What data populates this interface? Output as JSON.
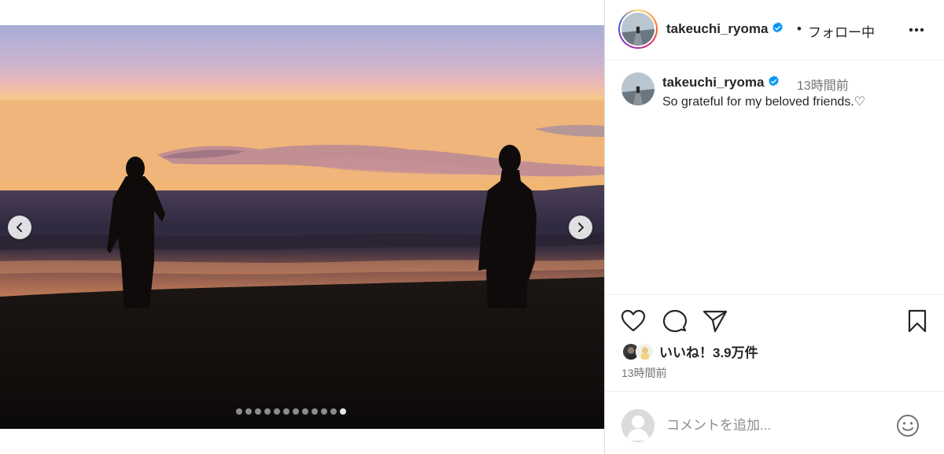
{
  "media": {
    "slide_count": 12,
    "active_slide_index": 11
  },
  "header": {
    "username": "takeuchi_ryoma",
    "separator": "•",
    "follow_status": "フォロー中"
  },
  "caption": {
    "username": "takeuchi_ryoma",
    "time_ago": "13時間前",
    "text": "So grateful for my beloved friends.♡"
  },
  "engagement": {
    "likes_text": "いいね！3.9万件",
    "post_time": "13時間前"
  },
  "comment": {
    "placeholder": "コメントを追加..."
  },
  "colors": {
    "verified": "#0095f6",
    "text_primary": "#262626",
    "text_secondary": "#737373"
  },
  "icons": [
    "chevron-left-icon",
    "chevron-right-icon",
    "more-icon",
    "verified-icon",
    "heart-icon",
    "comment-icon",
    "share-icon",
    "bookmark-icon",
    "emoji-icon",
    "default-avatar-icon"
  ]
}
